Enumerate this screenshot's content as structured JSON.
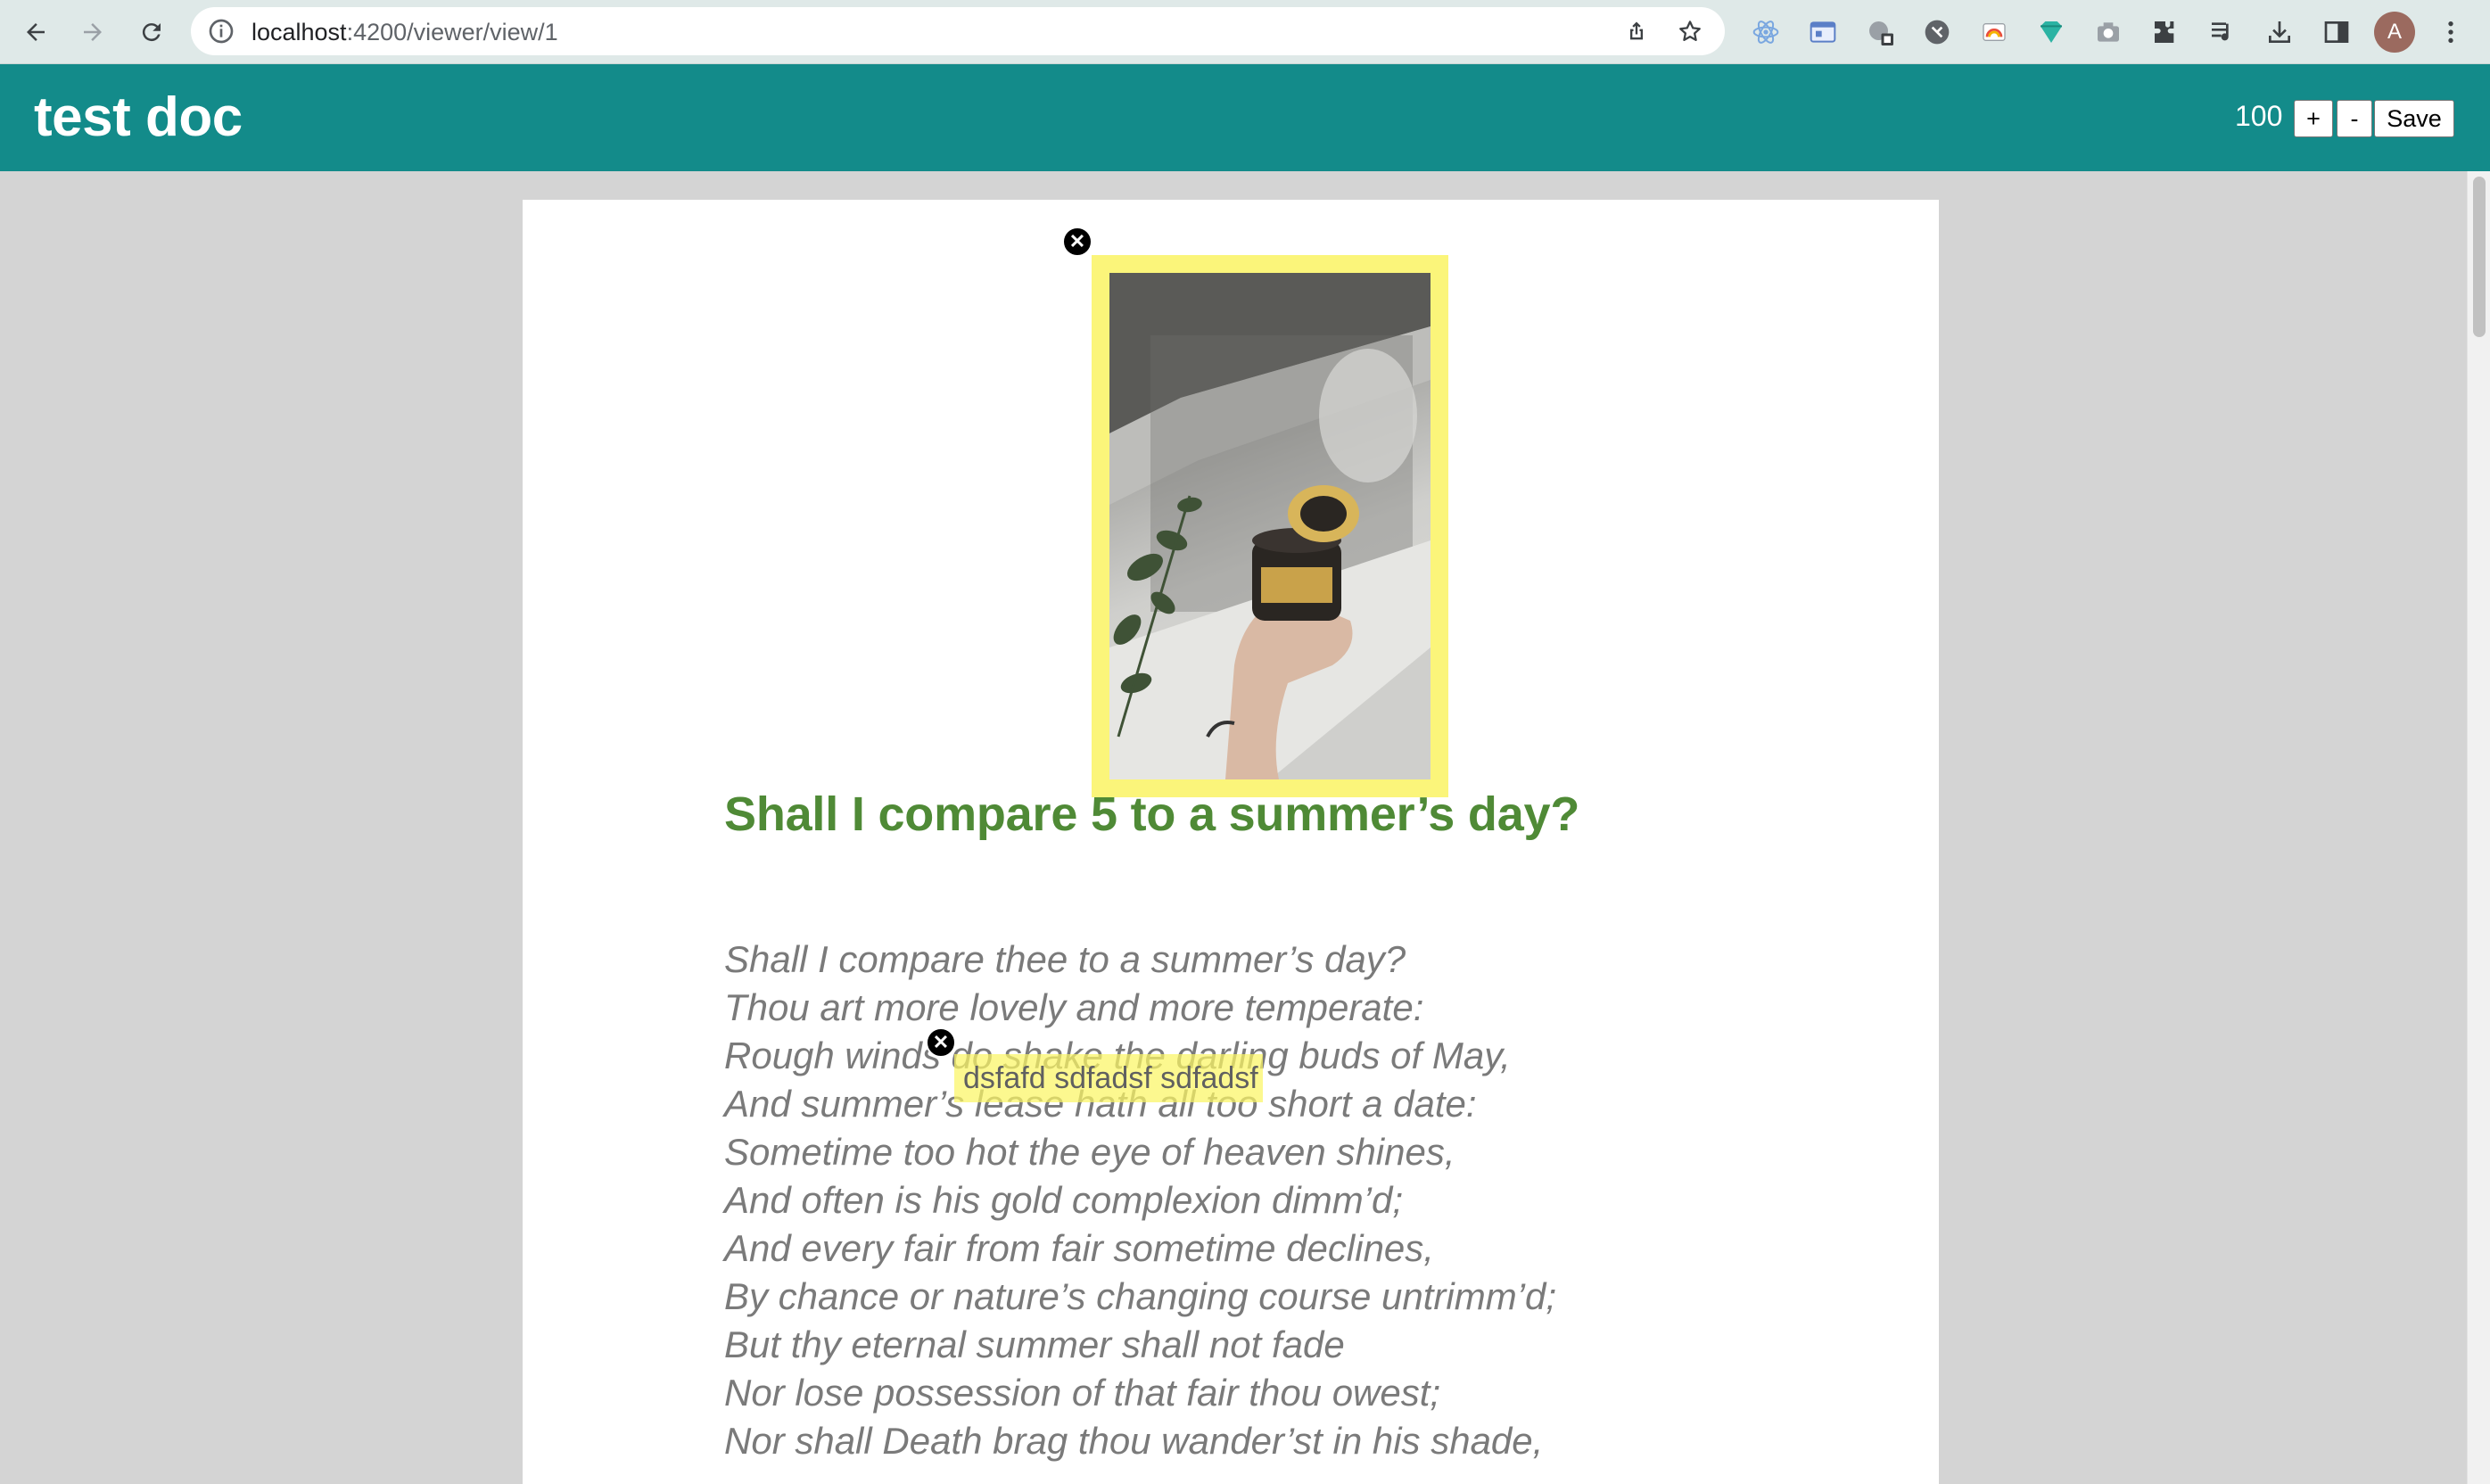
{
  "browser": {
    "url_host": "localhost",
    "url_path": ":4200/viewer/view/1",
    "avatar_letter": "A",
    "icons": [
      "back-icon",
      "forward-icon",
      "reload-icon",
      "info-icon",
      "share-icon",
      "star-icon",
      "extension-react-icon",
      "extension-window-icon",
      "extension-puzzle-badge-icon",
      "extension-circle-icon",
      "extension-rainbow-icon",
      "extension-diamond-icon",
      "extension-camera-icon",
      "extensions-icon",
      "reading-list-icon",
      "download-icon",
      "side-panel-icon",
      "menu-icon"
    ]
  },
  "header": {
    "title": "test doc",
    "zoom": "100",
    "zoom_in_label": "+",
    "zoom_out_label": "-",
    "save_label": "Save",
    "background_color": "#138b8a"
  },
  "document": {
    "heading": "Shall I compare 5 to a summer’s day?",
    "heading_color": "#4f8a36",
    "poem": [
      "Shall I compare thee to a summer’s day?",
      "Thou art more lovely and more temperate:",
      "Rough winds do shake the darling buds of May,",
      "And summer’s lease hath all too short a date:",
      "Sometime too hot the eye of heaven shines,",
      "And often is his gold complexion dimm’d;",
      "And every fair from fair sometime declines,",
      "By chance or nature’s changing course untrimm’d;",
      "But thy eternal summer shall not fade",
      "Nor lose possession of that fair thou owest;",
      "Nor shall Death brag thou wander’st in his shade,"
    ],
    "text_annotation": "dsfafd sdfadsf sdfadsf",
    "highlight_color": "#fbf57a",
    "image_annotation_close": "✕",
    "text_annotation_close": "✕"
  }
}
